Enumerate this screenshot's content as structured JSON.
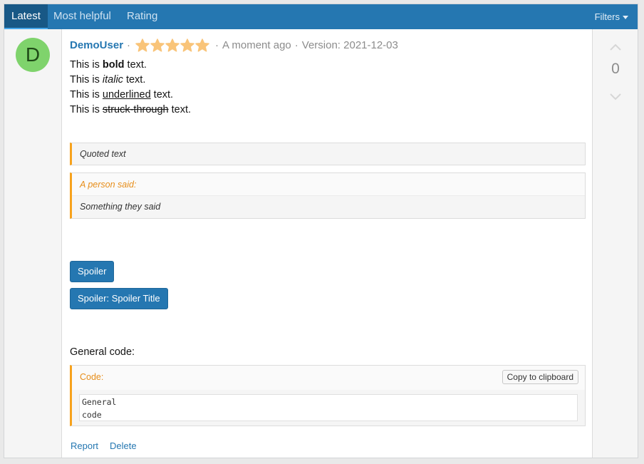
{
  "tabs": [
    {
      "label": "Latest"
    },
    {
      "label": "Most helpful"
    },
    {
      "label": "Rating"
    }
  ],
  "filters_label": "Filters",
  "review": {
    "avatar_letter": "D",
    "author": "DemoUser",
    "rating": 5,
    "rating_max": 5,
    "time": "A moment ago",
    "version": "Version: 2021-12-03",
    "separator": "·",
    "lines": [
      {
        "prefix": "This is ",
        "styled": "bold",
        "suffix": " text."
      },
      {
        "prefix": "This is ",
        "styled": "italic",
        "suffix": " text."
      },
      {
        "prefix": "This is ",
        "styled": "underlined",
        "suffix": " text."
      },
      {
        "prefix": "This is ",
        "styled": "struck-through",
        "suffix": " text."
      }
    ],
    "quote_text": "Quoted text",
    "quote2_attrib": "A person said:",
    "quote2_text": "Something they said",
    "spoiler_button": "Spoiler",
    "spoiler_title_button": "Spoiler: Spoiler Title",
    "code_intro": "General code:",
    "code_title": "Code:",
    "copy_button": "Copy to clipboard",
    "code_content": "General\ncode",
    "report_link": "Report",
    "delete_link": "Delete"
  },
  "votes": {
    "count": "0"
  },
  "colors": {
    "accent": "#2577b1",
    "star": "#f9c479",
    "quote_bar": "#f7a21c",
    "avatar_bg": "#7fd36c"
  }
}
